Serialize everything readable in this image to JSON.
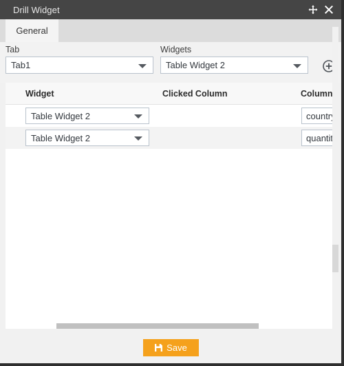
{
  "window": {
    "title": "Drill Widget",
    "move_icon": "move-cross-icon",
    "close_icon": "close-x-icon",
    "titlebar_color": "#454545"
  },
  "tabs": [
    {
      "label": "General",
      "active": true
    }
  ],
  "form": {
    "tab_field": {
      "label": "Tab",
      "value": "Tab1",
      "caret_icon": "chevron-down-icon"
    },
    "widgets_field": {
      "label": "Widgets",
      "value": "Table Widget 2",
      "caret_icon": "chevron-down-icon"
    },
    "add_button": {
      "icon": "plus-circle-icon",
      "label": ""
    }
  },
  "grid": {
    "columns": [
      {
        "key": "widget",
        "label": "Widget"
      },
      {
        "key": "clicked_column",
        "label": "Clicked Column"
      },
      {
        "key": "column_value",
        "label": "Column V"
      }
    ],
    "rows": [
      {
        "widget": "Table Widget 2",
        "clicked_column": "",
        "column_value": "country"
      },
      {
        "widget": "Table Widget 2",
        "clicked_column": "",
        "column_value": "quantity("
      }
    ]
  },
  "scrollbars": {
    "horizontal": {
      "thumb_label": "horizontal-scrollbar-thumb"
    },
    "vertical": {
      "thumb_label": "vertical-scrollbar-thumb"
    }
  },
  "footer": {
    "save_label": "Save",
    "save_icon": "floppy-disk-icon",
    "save_color": "#f5a11c"
  }
}
